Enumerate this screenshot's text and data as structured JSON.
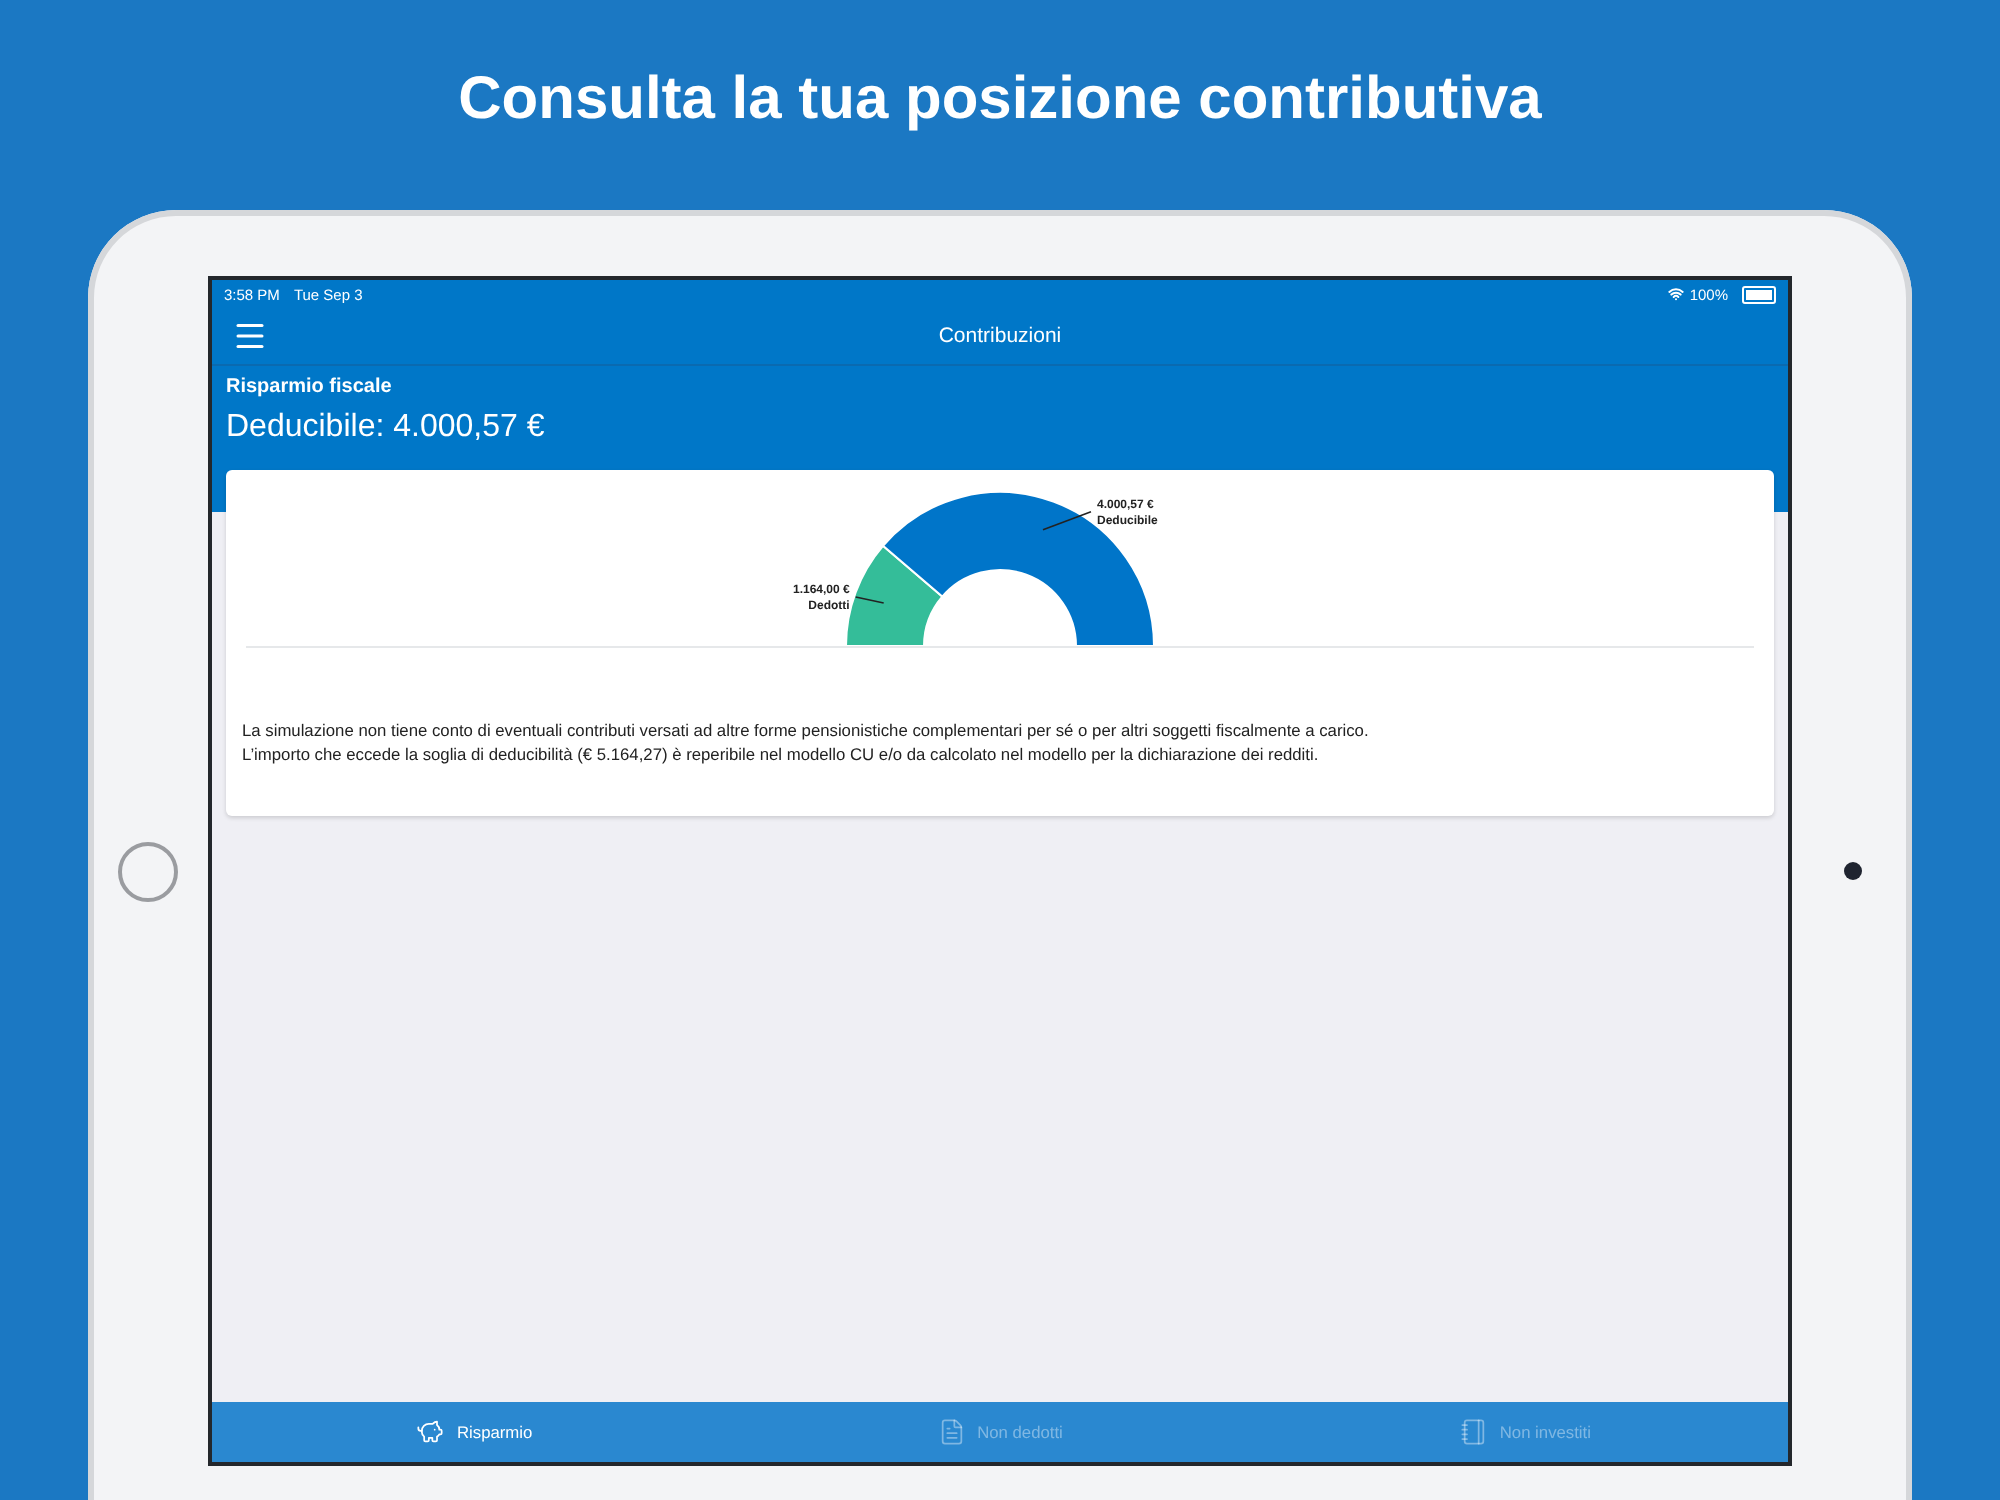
{
  "headline": "Consulta la tua posizione contributiva",
  "status_bar": {
    "time": "3:58 PM",
    "date": "Tue Sep 3",
    "battery": "100%"
  },
  "nav_bar": {
    "title": "Contribuzioni"
  },
  "summary": {
    "label": "Risparmio fiscale",
    "value": "Deducibile: 4.000,57 €"
  },
  "chart": {
    "chart_data": {
      "type": "donut",
      "categories": [
        "Dedotti",
        "Deducibile"
      ],
      "values": [
        1164.0,
        4000.57
      ],
      "value_labels": [
        "1.164,00 €",
        "4.000,57 €"
      ],
      "data_labels": true
    }
  },
  "note": [
    "La simulazione non tiene conto di eventuali contributi versati ad altre forme pensionistiche complementari per sé o per altri soggetti fiscalmente a carico.",
    "L’importo che eccede la soglia di deducibilità (€ 5.164,27) è reperibile nel modello CU e/o da calcolato nel modello per la dichiarazione dei redditi."
  ],
  "tabs": [
    {
      "label": "Risparmio",
      "selected": true
    },
    {
      "label": "Non dedotti",
      "selected": false
    },
    {
      "label": "Non investiti",
      "selected": false
    }
  ]
}
